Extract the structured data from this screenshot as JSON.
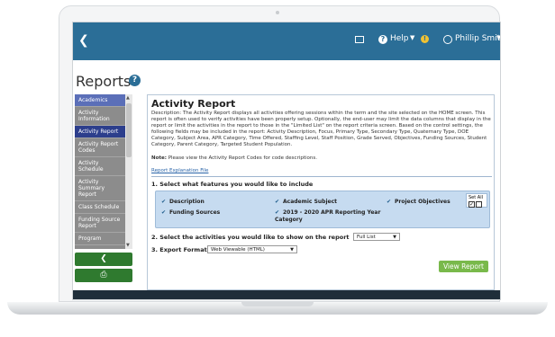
{
  "topbar": {
    "help_label": "Help",
    "badge": "!",
    "user_name": "Phillip Smith"
  },
  "page": {
    "title": "Reports"
  },
  "sidebar": {
    "items": [
      {
        "label": "Academics",
        "state": "header"
      },
      {
        "label": "Activity Information",
        "state": "normal"
      },
      {
        "label": "Activity Report",
        "state": "selected"
      },
      {
        "label": "Activity Report Codes",
        "state": "normal"
      },
      {
        "label": "Activity Schedule",
        "state": "normal"
      },
      {
        "label": "Activity Summary Report",
        "state": "normal"
      },
      {
        "label": "Class Schedule",
        "state": "normal"
      },
      {
        "label": "Funding Source Report",
        "state": "normal"
      },
      {
        "label": "Program",
        "state": "normal"
      }
    ]
  },
  "panel": {
    "title": "Activity Report",
    "description": "Description: The Activity Report displays all activities offering sessions within the term and the site selected on the HOME screen. This report is often used to verify activities have been properly setup. Optionally, the end-user may limit the data columns that display in the report or limit the activities in the report to those in the \"Limited List\" on the report criteria screen. Based on the control settings, the following fields may be included in the report: Activity Description, Focus, Primary Type, Secondary Type, Quaternary Type, DOE Category, Subject Area, APR Category, Time Offered, Staffing Level, Staff Position, Grade Served, Objectives, Funding Sources, Student Category, Parent Category, Targeted Student Population.",
    "note_label": "Note:",
    "note_text": "Please view the Activity Report Codes for code descriptions.",
    "link": "Report Explanation File",
    "section1": "1. Select what features you would like to include",
    "set_all": "Set All",
    "features": [
      "Description",
      "Academic Subject",
      "Project Objectives",
      "Funding Sources",
      "2019 - 2020 APR Reporting Year Category"
    ],
    "section2": "2. Select the activities you would like to show on the report",
    "activities_value": "Full List",
    "section3": "3. Export Format:",
    "export_value": "Web Viewable (HTML)",
    "view_button": "View Report"
  }
}
